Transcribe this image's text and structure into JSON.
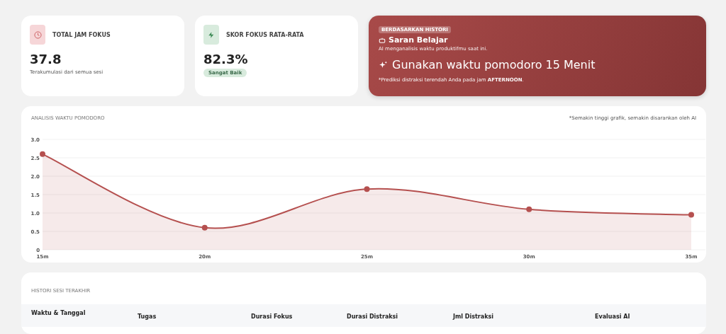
{
  "stats": [
    {
      "kind": "clock",
      "title": "TOTAL JAM FOKUS",
      "value": "37.8",
      "note": "Terakumulasi dari semua sesi"
    },
    {
      "kind": "bolt",
      "title": "SKOR FOKUS RATA-RATA",
      "value": "82.3%",
      "badge": "Sangat Baik"
    }
  ],
  "suggestion": {
    "tag": "BERDASARKAN HISTORI",
    "title": "Saran Belajar",
    "subtitle": "AI menganalisis waktu produktifmu saat ini.",
    "headline": "Gunakan waktu pomodoro 15 Menit",
    "footnote": "*Prediksi distraksi terendah Anda pada jam **AFTERNOON**."
  },
  "analysis": {
    "title": "ANALISIS WAKTU POMODORO",
    "note": "*Semakin tinggi grafik, semakin disarankan oleh AI",
    "chart_data": {
      "type": "area",
      "categories": [
        "15m",
        "20m",
        "25m",
        "30m",
        "35m"
      ],
      "series": [
        {
          "color": "#b5504f",
          "values": [
            2.6,
            0.6,
            1.65,
            1.1,
            0.95
          ]
        }
      ],
      "grid": true,
      "ylim": [
        0,
        3
      ],
      "yticks": [
        {
          "value": 0,
          "label": "0"
        },
        {
          "value": 0.5,
          "label": "0.5"
        },
        {
          "value": 1,
          "label": "1.0"
        },
        {
          "value": 1.5,
          "label": "1.5"
        },
        {
          "value": 2,
          "label": "2.0"
        },
        {
          "value": 2.5,
          "label": "2.5"
        },
        {
          "value": 3,
          "label": "3.0"
        }
      ]
    }
  },
  "history": {
    "title": "HISTORI SESI TERAKHIR",
    "columns": [
      "Waktu & Tanggal",
      "Tugas",
      "Durasi Fokus",
      "Durasi Distraksi",
      "Jml Distraksi",
      "Evaluasi AI"
    ]
  }
}
